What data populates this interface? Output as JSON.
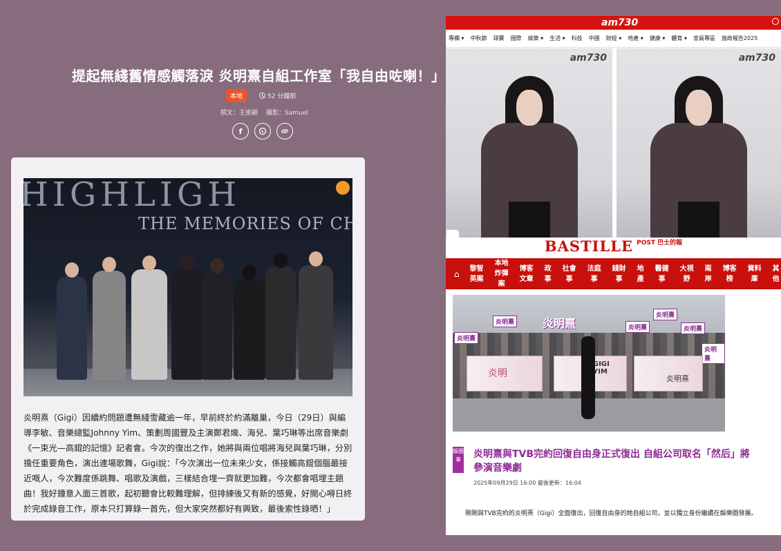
{
  "left": {
    "title": "提起無綫舊情感觸落淚 炎明熹自組工作室「我自由咗喇！」",
    "category": "本地",
    "time_ago": "52 分鐘前",
    "byline_author": "撰文：王崇穎",
    "byline_photo": "攝影：Samuel",
    "photo_text_top": "HIGHLIGH",
    "photo_text_sub": "THE MEMORIES OF CHAR",
    "body": "炎明熹（Gigi）因續約問題遭無綫雪藏逾一年，早前終於約滿離巢，今日（29日）與編導李敏、音樂總監Johnny Yim、策劃周國豐及主演鄭君熾、海兒、葉巧琳等出席音樂劇《一束光—高錕的記憶》記者會。今次的復出之作，她將與兩位唱將海兒與葉巧琳，分別擔任重要角色，演出連場歌舞，Gigi說：「今次演出一位未來少女，係接觸高錕個腦最接近嘅人，今次難度係跳舞、唱歌及演戲，三樣結合埋一齊就更加難，今次都會唱埋主題曲！我好鍾意入面三首歌，起初聽會比較難理解，但排練後又有新的感覺，好開心嘚日終於完成錄音工作，原本只打算錄一首先，但大家突然都好有興致，最後索性錄晒！」"
  },
  "right": {
    "am_logo": "am730",
    "am_nav": [
      "專欄 ▾",
      "中秋節",
      "球賽",
      "國際",
      "娛樂 ▾",
      "生活 ▾",
      "科技",
      "中國",
      "財經 ▾",
      "地產 ▾",
      "健康 ▾",
      "體育 ▾",
      "會員專區",
      "施政報告2025"
    ],
    "photo_watermark_left": "am730",
    "photo_watermark_right": "am730",
    "bastille_name": "BASTILLE",
    "bastille_sub": "POST 巴士的報",
    "bastille_nav": [
      "黎智英案",
      "本地炸彈案",
      "博客文章",
      "政事",
      "社會事",
      "法庭事",
      "錢財事",
      "地產",
      "醫健事",
      "大視野",
      "兩岸",
      "博客榜",
      "資料庫",
      "其他"
    ],
    "fan_title": "炎明熹",
    "fan_signs": [
      "炎明熹",
      "炎明熹",
      "炎明熹",
      "炎明熹",
      "炎明熹",
      "炎明熹"
    ],
    "banner_texts": [
      "炎明",
      "GIGI YIM",
      "炎明熹"
    ],
    "tag": "娛圈事",
    "headline": "炎明熹與TVB完約回復自由身正式復出 自組公司取名「然后」將參演音樂劇",
    "datetime": "2025年09月29日 16:00 最後更新：16:04",
    "lede": "剛剛與TVB完約的炎明熹（Gigi）全面復出，回復自由身的她自組公司，並以獨立身份繼續在娛樂圈發展。"
  }
}
